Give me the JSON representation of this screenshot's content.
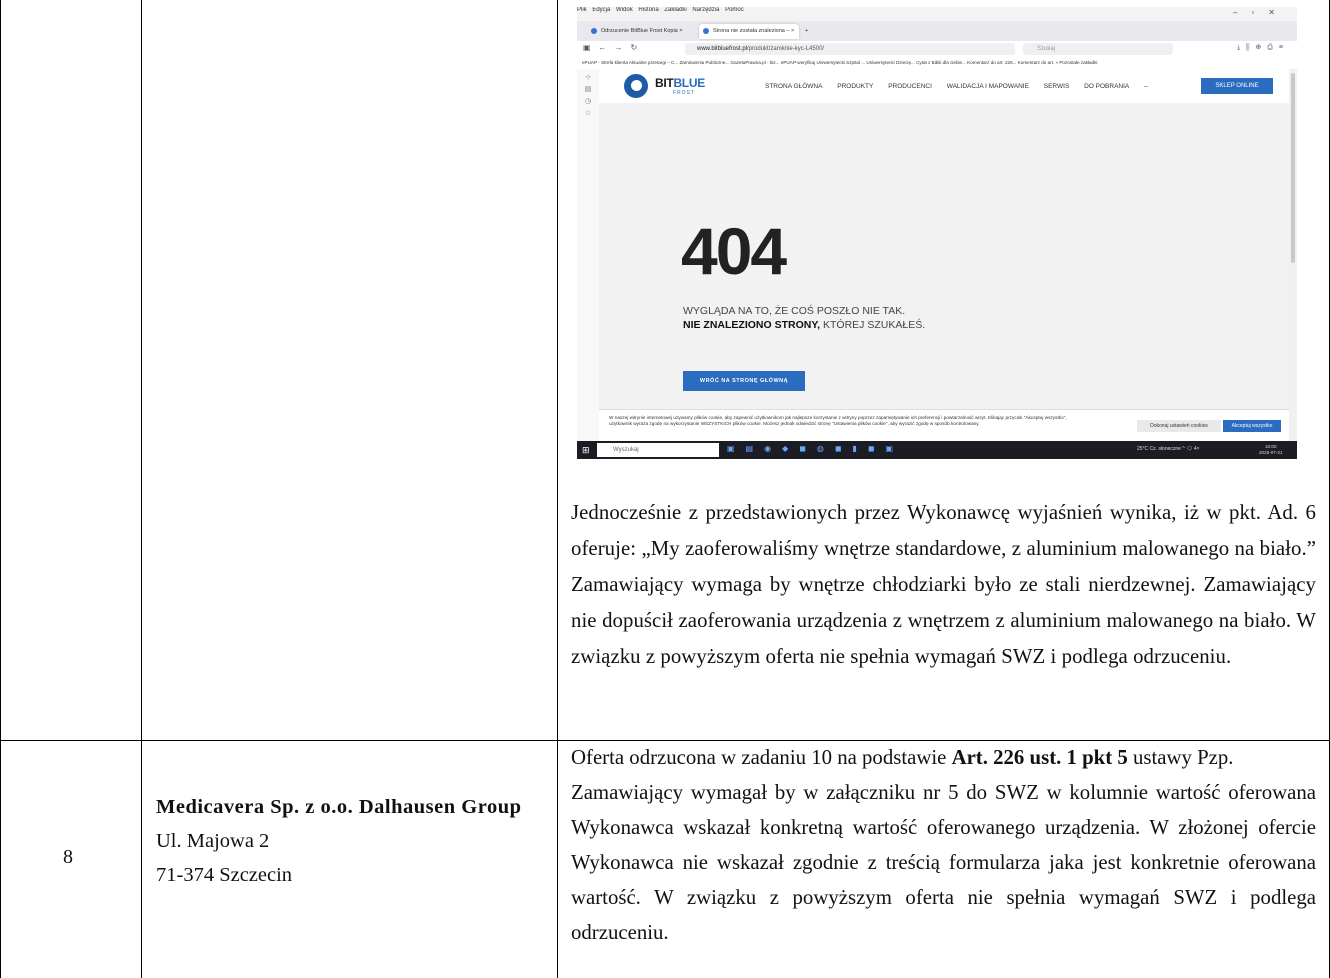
{
  "browser": {
    "menu": [
      "Plik",
      "Edycja",
      "Widok",
      "Historia",
      "Zakładki",
      "Narzędzia",
      "Pomoc"
    ],
    "tabs": [
      {
        "label": "Odrzucenie BitBlue Frost Kopia ×"
      },
      {
        "label": "Strona nie została znaleziona – ×"
      }
    ],
    "url_domain": "www.bitbluefrost.pl",
    "url_path": "/produkt/zamknie-kyc-L4500/",
    "search_placeholder": "Szukaj",
    "bookmarks": "ePUAP - Strefa klienta    Aktualne przetargi – C...    Zamówienia Publiczne...    GazetaPrawna.pl - biz...    ePUAP-weryfikuj    Uniwersytecki Szpital ...    Uniwersytecki Dziecię...    Cytat z Biblii dla ciebie...    Komentarz do art. 226...    Komentarz do art.    »    Pozostałe zakładki"
  },
  "site": {
    "logo_main": "BIT",
    "logo_accent": "BLUE",
    "logo_sub": "FROST",
    "nav": [
      "STRONA GŁÓWNA",
      "PRODUKTY",
      "PRODUCENCI",
      "WALIDACJA I MAPOWANIE",
      "SERWIS",
      "DO POBRANIA",
      "–"
    ],
    "shop_button": "SKLEP ONLINE",
    "error_code": "404",
    "message_line1": "WYGLĄDA NA TO, ŻE COŚ POSZŁO NIE TAK.",
    "message_line2_bold": "NIE ZNALEZIONO STRONY,",
    "message_line2_rest": " KTÓREJ SZUKAŁEŚ.",
    "home_button": "WRÓĆ NA STRONĘ GŁÓWNĄ",
    "cookie_text": "W naszej witrynie internetowej używamy plików cookie, aby zapewnić użytkownikom jak najlepsze korzystanie z witryny poprzez zapamiętywanie ich preferencji i powtarzalność wizyt. Klikając przycisk \"Akceptuj wszystko\", użytkownik wyraża zgodę na wykorzystanie WSZYSTKICH plików cookie. Możesz jednak odwiedzić stronę \"Ustawienia plików cookie\", aby wyrazić zgodę w sposób kontrolowany.",
    "cookie_settings": "Dokonaj ustawień cookies",
    "cookie_accept": "Akceptuj wszystko"
  },
  "taskbar": {
    "search": "Wyszukaj",
    "tray": "25°C  Cz. słoneczne   ^  🗨  4×",
    "time": "10:00",
    "date": "2025-07-21"
  },
  "doc": {
    "paragraph": "Jednocześnie z przedstawionych przez Wykonawcę wyjaśnień wynika, iż w pkt. Ad. 6 oferuje: „My zaoferowaliśmy wnętrze standardowe, z aluminium malowanego na biało.”  Zamawiający wymaga by wnętrze chłodziarki było ze stali nierdzewnej. Zamawiający nie dopuścił zaoferowania urządzenia z wnętrzem z aluminium malowanego na biało. W związku z powyższym oferta nie spełnia wymagań SWZ i podlega odrzuceniu.",
    "row": {
      "number": "8",
      "vendor_name": "Medicavera Sp. z o.o. Dalhausen Group",
      "street": "Ul. Majowa 2",
      "city": "71-374 Szczecin",
      "reason_start": "Oferta odrzucona w zadaniu 10 na podstawie ",
      "reason_bold": "Art. 226 ust. 1 pkt 5",
      "reason_rest": " ustawy Pzp.",
      "reason_para": "Zamawiający wymagał by w załączniku nr 5 do SWZ w kolumnie wartość oferowana Wykonawca wskazał konkretną wartość oferowanego urządzenia. W złożonej ofercie Wykonawca nie wskazał zgodnie z treścią formularza jaka jest konkretnie oferowana wartość. W związku z powyższym oferta nie spełnia wymagań SWZ i podlega odrzuceniu."
    }
  }
}
